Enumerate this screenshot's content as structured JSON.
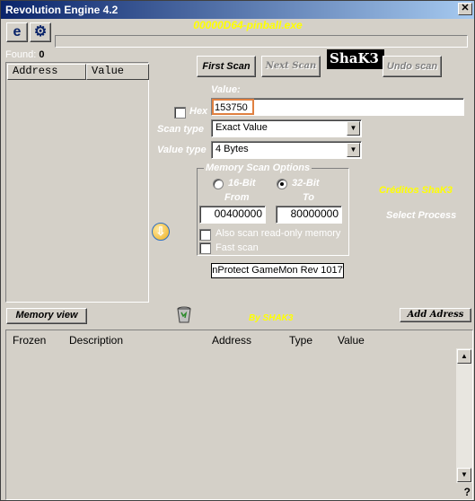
{
  "window": {
    "title": "Revolution Engine 4.2"
  },
  "toolbar": {
    "process_name": "00000D64-pinball.exe",
    "logo_text": "ShaK3"
  },
  "found": {
    "label": "Found:",
    "count": "0"
  },
  "result_list": {
    "columns": [
      "Address",
      "Value"
    ]
  },
  "scan": {
    "first_scan": "First Scan",
    "next_scan": "Next Scan",
    "undo_scan": "Undo scan",
    "value_label": "Value:",
    "value": "153750",
    "hex_label": "Hex",
    "scan_type_label": "Scan type",
    "scan_type": "Exact Value",
    "value_type_label": "Value type",
    "value_type": "4 Bytes"
  },
  "memory_options": {
    "title": "Memory Scan Options",
    "bit16": "16-Bit",
    "bit32": "32-Bit",
    "selected": "32-Bit",
    "from_label": "From",
    "to_label": "To",
    "from": "00400000",
    "to": "80000000",
    "readonly_label": "Also scan read-only memory",
    "fast_label": "Fast scan"
  },
  "info": {
    "credits": "Créditos ShaK3",
    "select_process": "Select Process",
    "protect": "nProtect GameMon Rev 1017",
    "by": "By SHAK3"
  },
  "bottom": {
    "memory_view": "Memory view",
    "add_address": "Add Adress"
  },
  "address_table": {
    "columns": [
      "Frozen",
      "Description",
      "Address",
      "Type",
      "Value"
    ]
  },
  "icons": {
    "toolbar_1": "ie-globe-icon",
    "toolbar_2": "open-process-icon",
    "arrow": "arrow-down-icon",
    "trash": "recycle-bin-icon",
    "help": "help-icon"
  },
  "colors": {
    "accent_yellow": "#ffff00",
    "title_blue": "#0a246a",
    "face": "#d4d0c8"
  }
}
